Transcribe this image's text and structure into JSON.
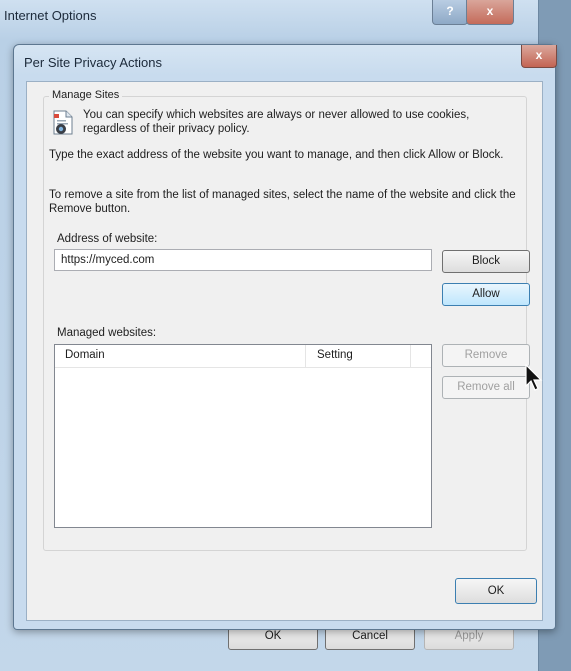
{
  "outer_window": {
    "title": "Internet Options",
    "caption_buttons": {
      "help": "?",
      "close": "x"
    },
    "footer": {
      "ok": "OK",
      "cancel": "Cancel",
      "apply": "Apply"
    }
  },
  "dialog": {
    "title": "Per Site Privacy Actions",
    "close": "x",
    "group_label": "Manage Sites",
    "intro_text": "You can specify which websites are always or never allowed to use cookies, regardless of their privacy policy.",
    "instruction_1": "Type the exact address of the website you want to manage, and then click Allow or Block.",
    "instruction_2": "To remove a site from the list of managed sites, select the name of the website and click the Remove button.",
    "address_label": "Address of website:",
    "address_value": "https://myced.com",
    "block_button": "Block",
    "allow_button": "Allow",
    "managed_label": "Managed websites:",
    "list_columns": [
      "Domain",
      "Setting"
    ],
    "remove_button": "Remove",
    "remove_all_button": "Remove all",
    "ok_button": "OK"
  },
  "colors": {
    "window_frame": "#c8dbee",
    "client_bg": "#f0f0f0",
    "close_button": "#c46b5a",
    "focus_button_border": "#3c7fb1"
  }
}
